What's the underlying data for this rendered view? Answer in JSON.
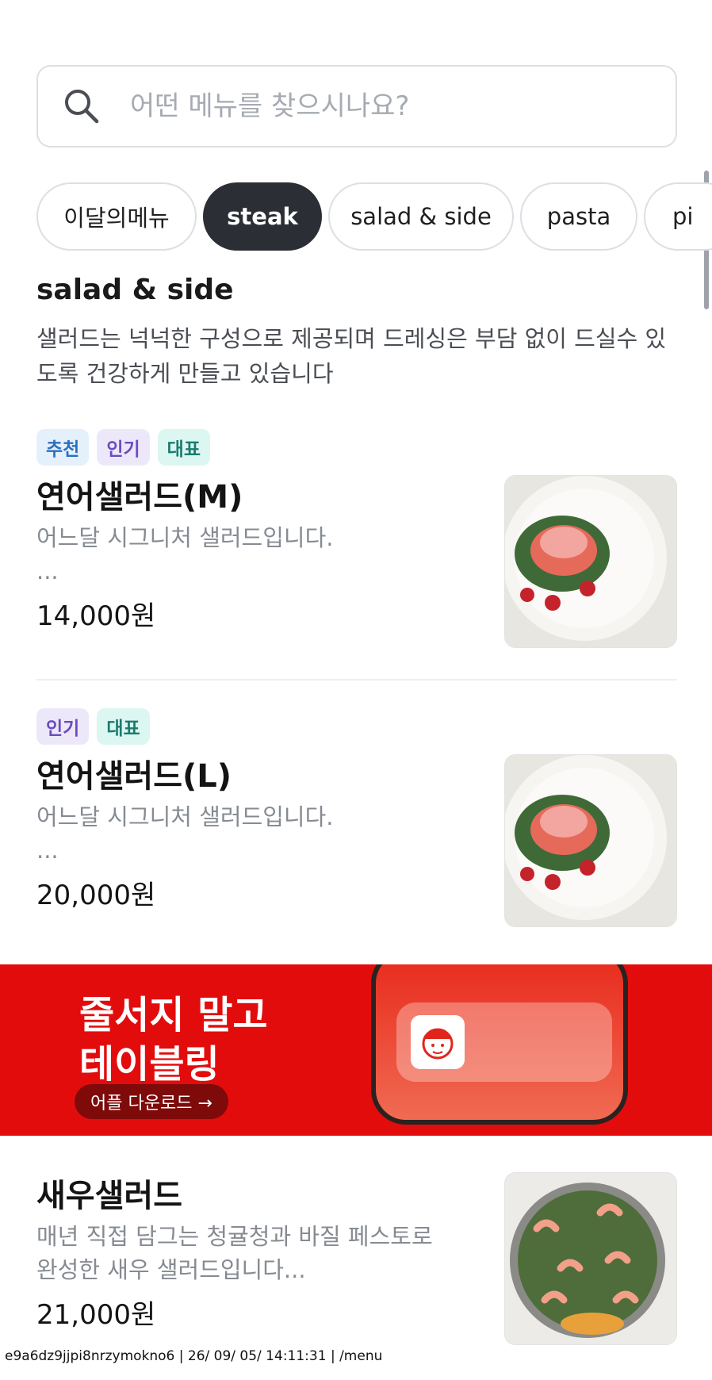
{
  "search": {
    "placeholder": "어떤 메뉴를 찾으시나요?"
  },
  "tabs": [
    {
      "label": "이달의메뉴",
      "active": false
    },
    {
      "label": "steak",
      "active": true
    },
    {
      "label": "salad & side",
      "active": false
    },
    {
      "label": "pasta",
      "active": false
    },
    {
      "label": "pi",
      "active": false
    }
  ],
  "section": {
    "title": "salad & side",
    "description": "샐러드는 넉넉한 구성으로 제공되며 드레싱은 부담 없이 드실수 있도록 건강하게 만들고 있습니다"
  },
  "items": [
    {
      "badges": [
        "추천",
        "인기",
        "대표"
      ],
      "name": "연어샐러드(M)",
      "desc_line1": "어느달 시그니처 샐러드입니다.",
      "desc_line2": "...",
      "price": "14,000원"
    },
    {
      "badges": [
        "인기",
        "대표"
      ],
      "name": "연어샐러드(L)",
      "desc_line1": "어느달 시그니처 샐러드입니다.",
      "desc_line2": "...",
      "price": "20,000원"
    },
    {
      "badges": [],
      "name": "새우샐러드",
      "desc_line1": "매년 직접 담그는 청귤청과 바질 페스토로",
      "desc_line2": "완성한 새우 샐러드입니다...",
      "price": "21,000원"
    }
  ],
  "banner": {
    "line1": "줄서지 말고",
    "line2": "테이블링",
    "cta": "어플 다운로드 →",
    "bg_color": "#e30c0c"
  },
  "footer": {
    "text": "e9a6dz9jjpi8nrzymokno6 | 26/ 09/ 05/ 14:11:31 | /menu"
  },
  "colors": {
    "active_tab": "#2b2f35",
    "badge_blue": "#2a6fc0",
    "badge_purple": "#6b4bbf",
    "badge_teal": "#1b7c6e"
  }
}
